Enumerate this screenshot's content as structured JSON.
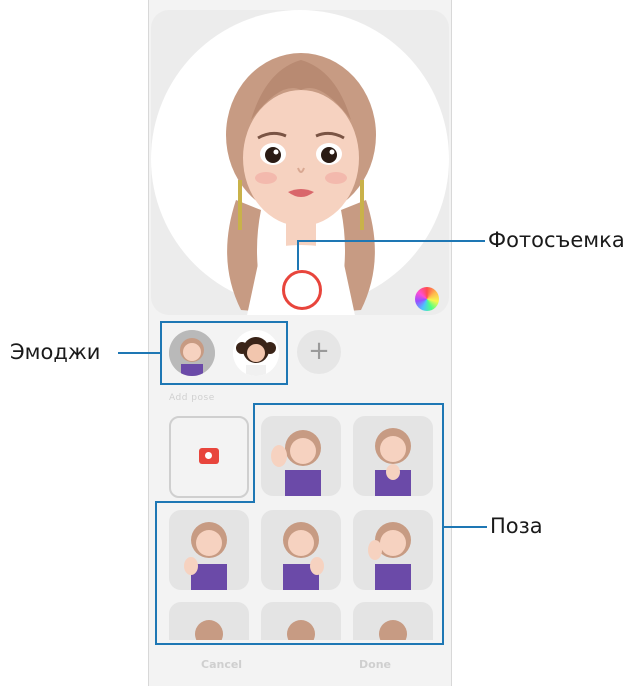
{
  "callouts": {
    "capture": "Фотосъемка",
    "emoji": "Эмоджи",
    "pose": "Поза"
  },
  "add_button": "+",
  "section_label": "Add pose",
  "buttons": {
    "cancel": "Cancel",
    "done": "Done"
  },
  "colors": {
    "callout_line": "#1e77b4",
    "shutter_ring": "#e8453c",
    "camera_icon": "#e8453c",
    "shirt": "#6b4aa8",
    "hair": "#c79b83"
  }
}
